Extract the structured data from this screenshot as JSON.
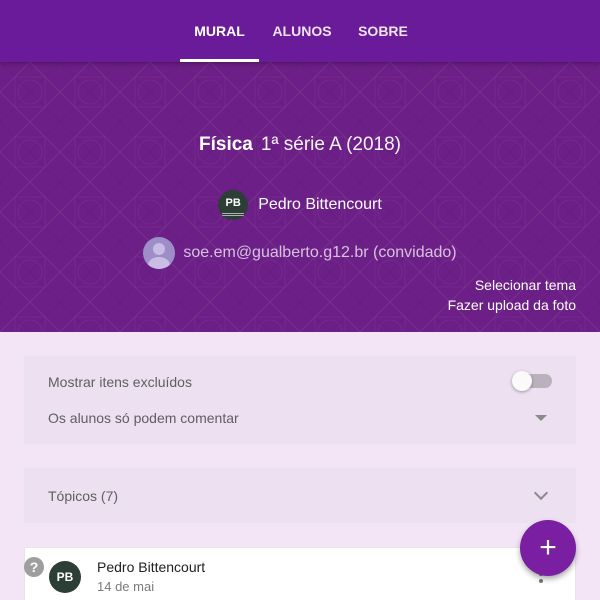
{
  "nav": {
    "tabs": [
      {
        "label": "MURAL",
        "active": true
      },
      {
        "label": "ALUNOS",
        "active": false
      },
      {
        "label": "SOBRE",
        "active": false
      }
    ]
  },
  "course": {
    "subject": "Física",
    "section": "1ª série A (2018)",
    "teacher_name": "Pedro Bittencourt",
    "teacher_initials": "PB",
    "guest_line": "soe.em@gualberto.g12.br (convidado)",
    "select_theme": "Selecionar tema",
    "upload_photo": "Fazer upload da foto"
  },
  "settings": {
    "show_deleted_label": "Mostrar itens excluídos",
    "show_deleted_enabled": false,
    "students_permission": "Os alunos só podem comentar"
  },
  "topics": {
    "label": "Tópicos (7)"
  },
  "post": {
    "author": "Pedro Bittencourt",
    "author_initials": "PB",
    "date": "14 de mai"
  },
  "icons": {
    "help": "?",
    "fab": "+"
  },
  "colors": {
    "primary": "#6a1b9a",
    "banner": "#6c1f86",
    "background": "#f3e5f5",
    "card": "#ece0f1",
    "fab": "#7b1fa2"
  }
}
